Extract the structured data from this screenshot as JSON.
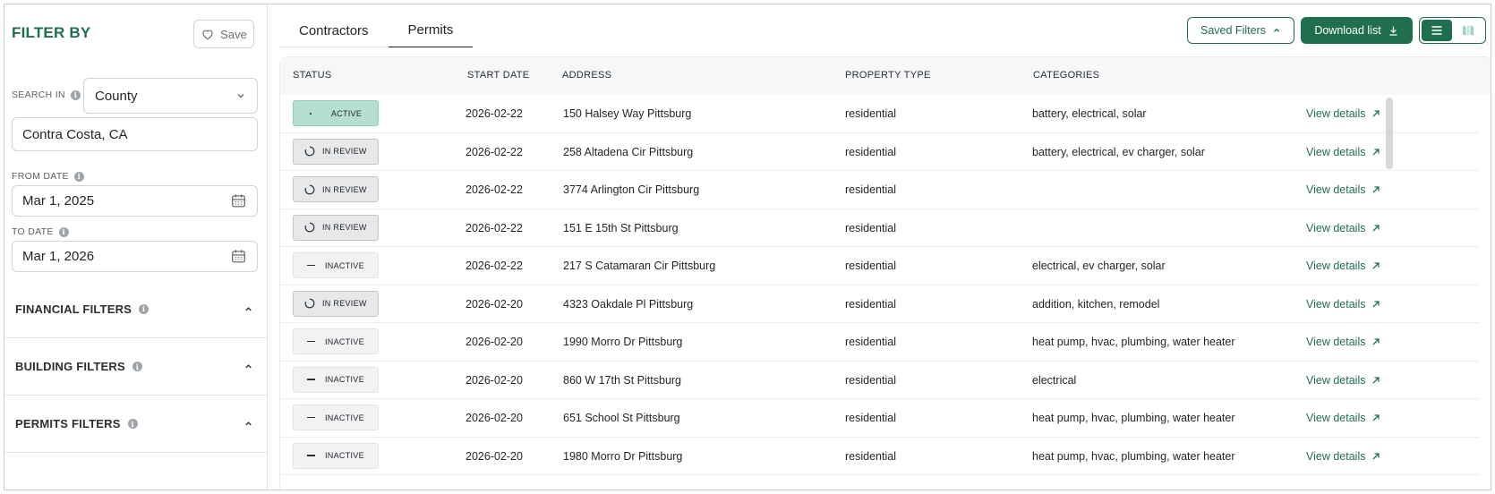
{
  "sidebar": {
    "title": "FILTER BY",
    "save_label": "Save",
    "search_in_label": "SEARCH IN",
    "search_in_value": "County",
    "location_value": "Contra Costa, CA",
    "from_date_label": "FROM DATE",
    "from_date_value": "Mar 1, 2025",
    "to_date_label": "TO DATE",
    "to_date_value": "Mar 1, 2026",
    "sections": [
      {
        "label": "FINANCIAL FILTERS"
      },
      {
        "label": "BUILDING FILTERS"
      },
      {
        "label": "PERMITS FILTERS"
      }
    ]
  },
  "tabs": [
    {
      "label": "Contractors"
    },
    {
      "label": "Permits"
    }
  ],
  "toolbar": {
    "saved_filters_label": "Saved Filters",
    "download_label": "Download list"
  },
  "table": {
    "headers": [
      "STATUS",
      "START DATE",
      "ADDRESS",
      "PROPERTY TYPE",
      "CATEGORIES"
    ],
    "link_label": "View details",
    "rows": [
      {
        "status": "ACTIVE",
        "kind": "active",
        "date": "2026-02-22",
        "address": "150 Halsey Way Pittsburg",
        "type": "residential",
        "categories": "battery, electrical, solar"
      },
      {
        "status": "IN REVIEW",
        "kind": "review",
        "date": "2026-02-22",
        "address": "258 Altadena Cir Pittsburg",
        "type": "residential",
        "categories": "battery, electrical, ev charger, solar"
      },
      {
        "status": "IN REVIEW",
        "kind": "review",
        "date": "2026-02-22",
        "address": "3774 Arlington Cir Pittsburg",
        "type": "residential",
        "categories": ""
      },
      {
        "status": "IN REVIEW",
        "kind": "review",
        "date": "2026-02-22",
        "address": "151 E 15th St Pittsburg",
        "type": "residential",
        "categories": ""
      },
      {
        "status": "INACTIVE",
        "kind": "inactive",
        "date": "2026-02-22",
        "address": "217 S Catamaran Cir Pittsburg",
        "type": "residential",
        "categories": "electrical, ev charger, solar"
      },
      {
        "status": "IN REVIEW",
        "kind": "review",
        "date": "2026-02-20",
        "address": "4323 Oakdale Pl Pittsburg",
        "type": "residential",
        "categories": "addition, kitchen, remodel"
      },
      {
        "status": "INACTIVE",
        "kind": "inactive",
        "date": "2026-02-20",
        "address": "1990 Morro Dr Pittsburg",
        "type": "residential",
        "categories": "heat pump, hvac, plumbing, water heater"
      },
      {
        "status": "INACTIVE",
        "kind": "inactive",
        "date": "2026-02-20",
        "address": "860 W 17th St Pittsburg",
        "type": "residential",
        "categories": "electrical"
      },
      {
        "status": "INACTIVE",
        "kind": "inactive",
        "date": "2026-02-20",
        "address": "651 School St Pittsburg",
        "type": "residential",
        "categories": "heat pump, hvac, plumbing, water heater"
      },
      {
        "status": "INACTIVE",
        "kind": "inactive",
        "date": "2026-02-20",
        "address": "1980 Morro Dr Pittsburg",
        "type": "residential",
        "categories": "heat pump, hvac, plumbing, water heater"
      }
    ]
  },
  "colors": {
    "brand": "#1f6e4d",
    "active_badge": "#b5dfd2",
    "review_badge": "#e6e8ea",
    "inactive_badge": "#f1f2f3"
  }
}
